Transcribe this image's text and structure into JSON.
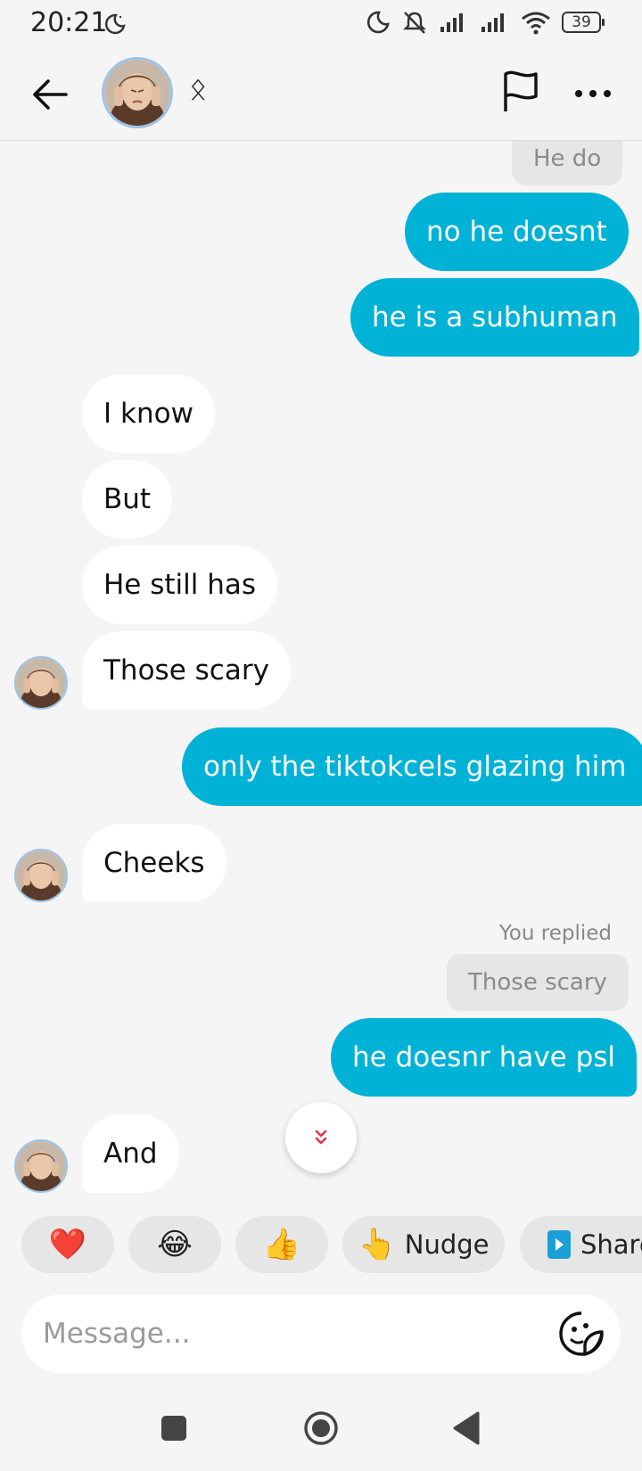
{
  "status_bar": {
    "time": "20:21",
    "battery": "39"
  },
  "colors": {
    "outgoing_bubble": "#00b2d6",
    "incoming_bubble": "#ffffff",
    "background": "#f5f5f5",
    "quote_bubble": "#e6e6e6"
  },
  "header": {
    "status_glyph": "ᛟ"
  },
  "chat": {
    "quoted_top": "He do",
    "messages": [
      {
        "text": "no he doesnt"
      },
      {
        "text": "he is a subhuman"
      },
      {
        "text": "I know"
      },
      {
        "text": "But"
      },
      {
        "text": "He still has"
      },
      {
        "text": "Those scary"
      },
      {
        "text": "only the tiktokcels glazing him"
      },
      {
        "text": "Cheeks"
      },
      {
        "text": "he doesnr have psl"
      },
      {
        "text": "And"
      }
    ],
    "reply_label": "You replied",
    "reply_quote": "Those scary"
  },
  "quick_reactions": [
    {
      "emoji": "❤️",
      "label": ""
    },
    {
      "emoji": "😂",
      "label": ""
    },
    {
      "emoji": "👍",
      "label": ""
    },
    {
      "emoji": "👆",
      "label": "Nudge"
    },
    {
      "emoji": "",
      "label": "Share"
    }
  ],
  "composer": {
    "placeholder": "Message..."
  },
  "icons": [
    "back-arrow-icon",
    "flag-icon",
    "more-icon",
    "sticker-icon",
    "scroll-down-icon",
    "share-icon",
    "nav-recents-icon",
    "nav-home-icon",
    "nav-back-icon"
  ]
}
